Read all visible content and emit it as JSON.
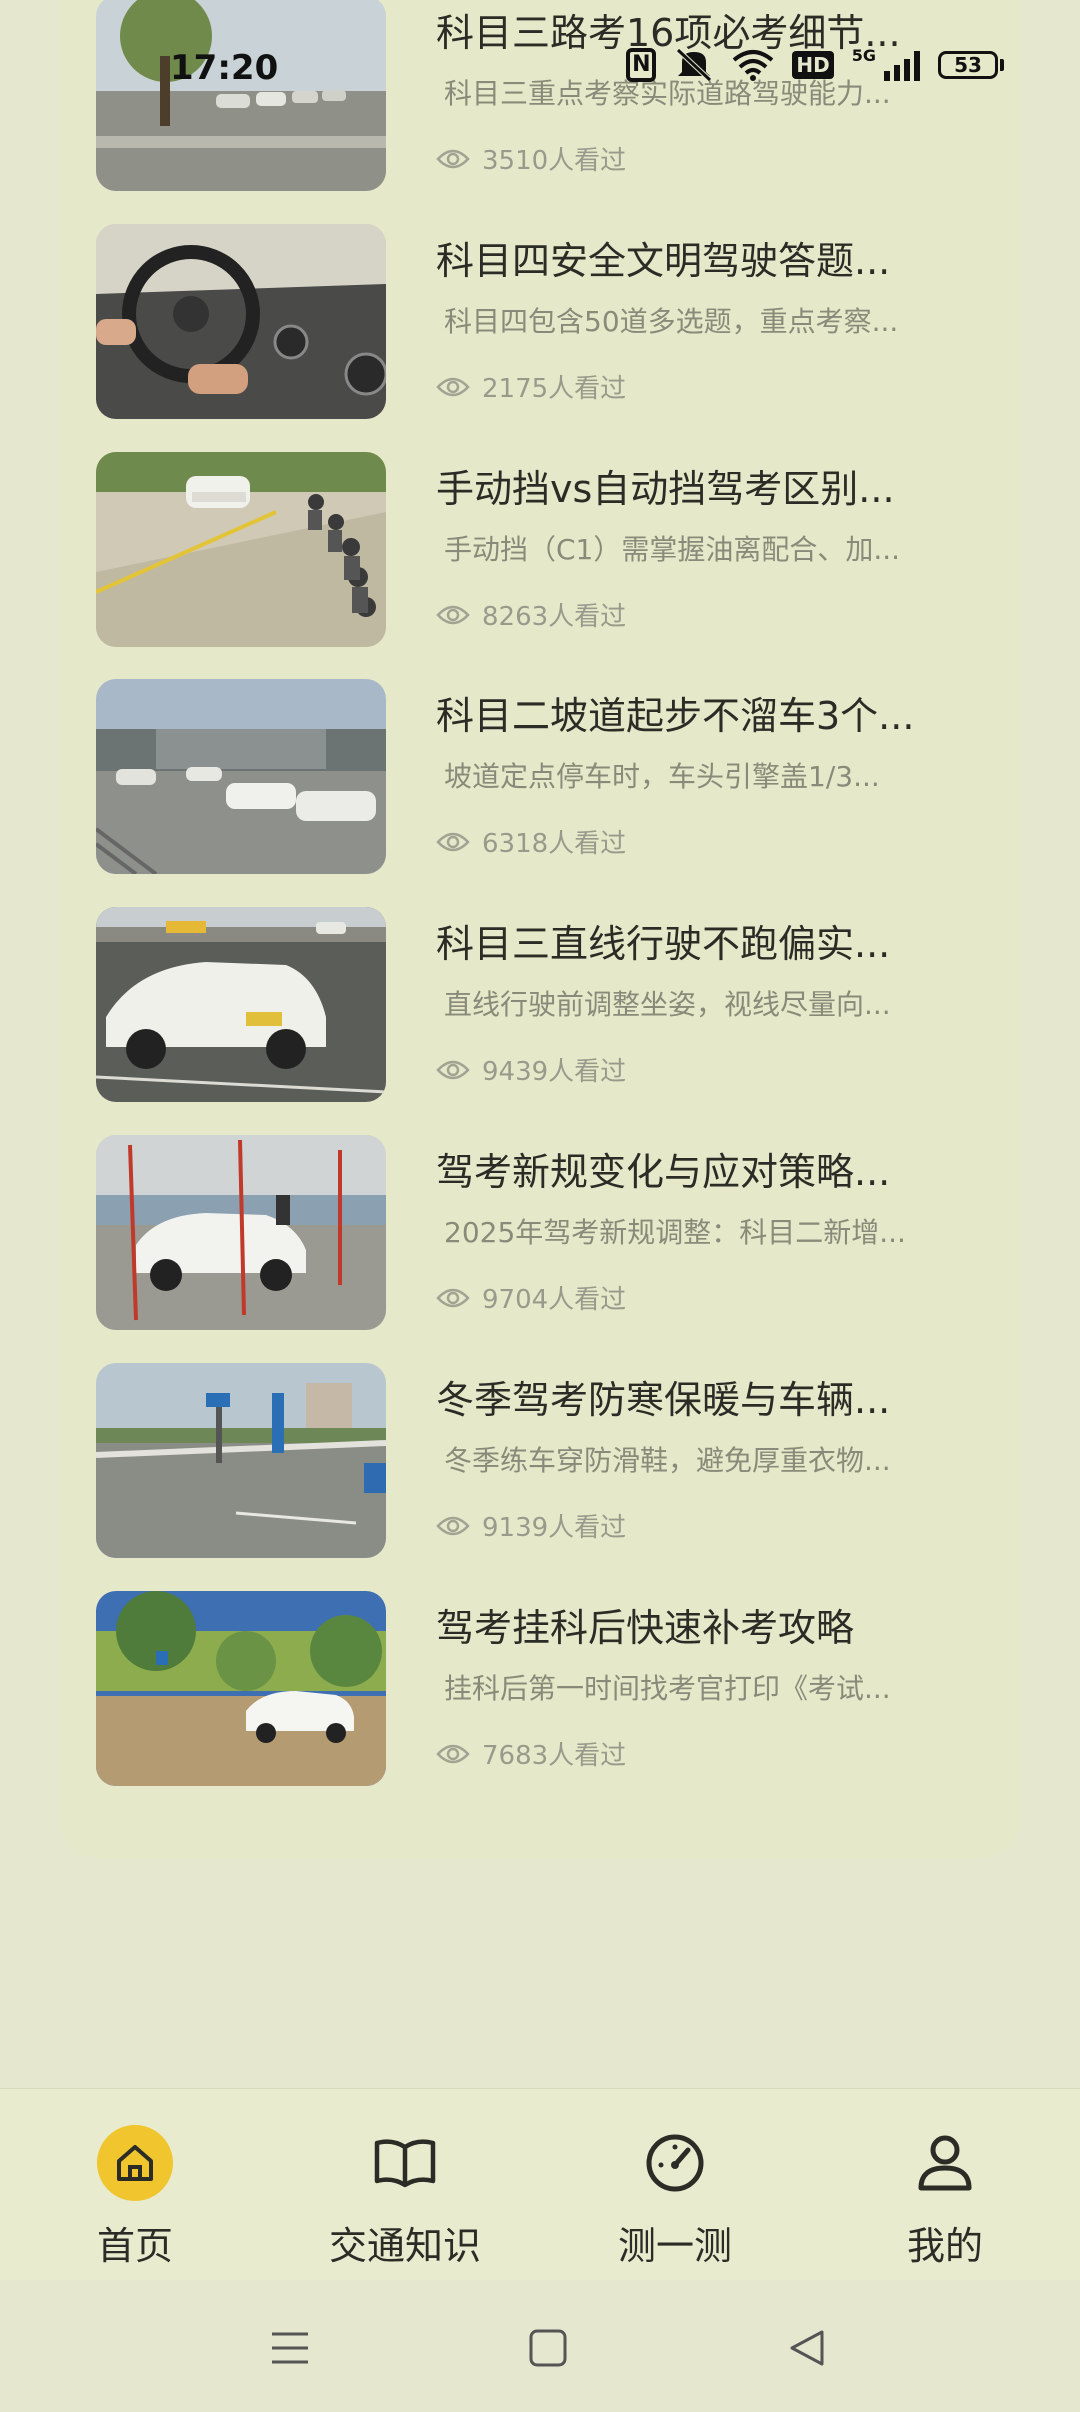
{
  "status": {
    "time": "17:20",
    "battery": "53",
    "network": "5G",
    "hd": "HD",
    "nfc": "N"
  },
  "articles": [
    {
      "title": "科目三路考16项必考细节...",
      "desc": "科目三重点考察实际道路驾驶能力...",
      "views": "3510人看过",
      "scene": "parking"
    },
    {
      "title": "科目四安全文明驾驶答题...",
      "desc": "科目四包含50道多选题，重点考察...",
      "views": "2175人看过",
      "scene": "steering"
    },
    {
      "title": "手动挡vs自动挡驾考区别...",
      "desc": "手动挡（C1）需掌握油离配合、加...",
      "views": "8263人看过",
      "scene": "field-people"
    },
    {
      "title": "科目二坡道起步不溜车3个...",
      "desc": "坡道定点停车时，车头引擎盖1/3...",
      "views": "6318人看过",
      "scene": "lot"
    },
    {
      "title": "科目三直线行驶不跑偏实...",
      "desc": "直线行驶前调整坐姿，视线尽量向...",
      "views": "9439人看过",
      "scene": "taxi"
    },
    {
      "title": "驾考新规变化与应对策略...",
      "desc": "2025年驾考新规调整：科目二新增...",
      "views": "9704人看过",
      "scene": "poles"
    },
    {
      "title": "冬季驾考防寒保暖与车辆...",
      "desc": "冬季练车穿防滑鞋，避免厚重衣物...",
      "views": "9139人看过",
      "scene": "city"
    },
    {
      "title": "驾考挂科后快速补考攻略",
      "desc": "挂科后第一时间找考官打印《考试...",
      "views": "7683人看过",
      "scene": "trees"
    }
  ],
  "nav": [
    {
      "label": "首页",
      "icon": "home-icon",
      "active": true
    },
    {
      "label": "交通知识",
      "icon": "book-icon",
      "active": false
    },
    {
      "label": "测一测",
      "icon": "gauge-icon",
      "active": false
    },
    {
      "label": "我的",
      "icon": "user-icon",
      "active": false
    }
  ],
  "system_nav": [
    "menu-icon",
    "home-square-icon",
    "back-icon"
  ],
  "colors": {
    "background": "#e5e8cf",
    "card": "#e6e9c9",
    "accent": "#f0c52d",
    "text": "#2c2c27",
    "muted": "#8a8a7a"
  }
}
